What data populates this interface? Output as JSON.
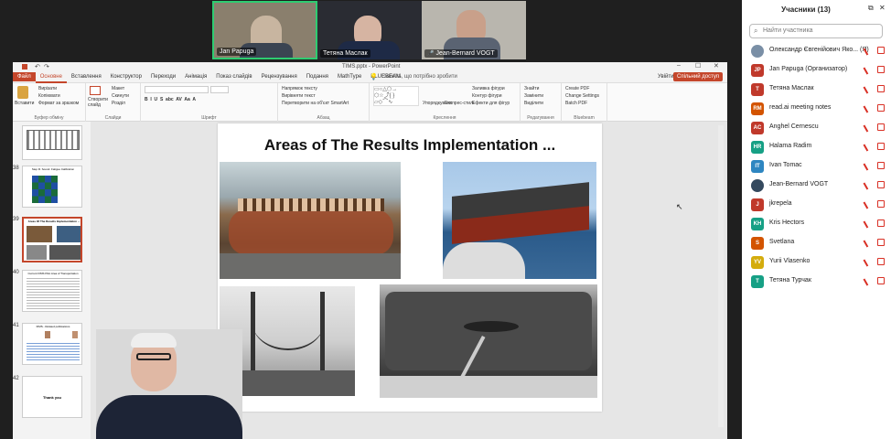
{
  "video_tiles": [
    {
      "name": "Jan Papuga",
      "mic": false
    },
    {
      "name": "Тетяна Маслак",
      "mic": false
    },
    {
      "name": "Jean-Bernard VOGT",
      "mic": true
    }
  ],
  "ppt": {
    "title": "TIMS.pptx - PowerPoint",
    "search_placeholder": "Скажіть, що потрібно зробити",
    "login_label": "Увійти",
    "share_label": "Спільний доступ",
    "tabs": [
      "Файл",
      "Основне",
      "Вставлення",
      "Конструктор",
      "Переходи",
      "Анімація",
      "Показ слайдів",
      "Рецензування",
      "Подання",
      "MathType",
      "BLUEBEAM"
    ],
    "ribbon": {
      "paste": "Вставити",
      "cut": "Вирізати",
      "copy": "Копіювати",
      "format_painter": "Формат за зразком",
      "clipboard": "Буфер обміну",
      "new_slide": "Створити слайд",
      "layout": "Макет",
      "reset": "Скинути",
      "section": "Розділ",
      "slides_group": "Слайди",
      "font_group": "Шрифт",
      "text_direction": "Напрямок тексту",
      "align_text": "Вирівняти текст",
      "smartart": "Перетворити на об'єкт SmartArt",
      "paragraph_group": "Абзац",
      "arrange": "Упорядкувати",
      "quick_styles": "Експрес-стилі",
      "shape_fill": "Заливка фігури",
      "shape_outline": "Контур фігури",
      "shape_effects": "Ефекти для фігур",
      "drawing_group": "Креслення",
      "find": "Знайти",
      "replace": "Замінити",
      "select": "Виділити",
      "editing_group": "Редагування",
      "create_pdf": "Create PDF",
      "change_settings": "Change Settings",
      "batch_pdf": "Batch PDF",
      "bluebeam_group": "Bluebeam"
    },
    "thumbs": [
      {
        "num": "",
        "title": ""
      },
      {
        "num": "38",
        "title": "Step R. Sound. Fatigue Calibration"
      },
      {
        "num": "39",
        "title": "Areas Of The Results Implementation ..."
      },
      {
        "num": "40",
        "title": "Current FIMS Pilot Area of Transportation"
      },
      {
        "num": "41",
        "title": "FIMS - Related publications"
      },
      {
        "num": "42",
        "title": "Thank you"
      }
    ],
    "slide": {
      "title": "Areas of The Results Implementation ..."
    }
  },
  "participants": {
    "header": "Учасники (13)",
    "search_placeholder": "Найти участника",
    "list": [
      {
        "initials": "",
        "name": "Олександр Євгенійович Яко... (Я)",
        "color": "#7a8fa6",
        "photo": true
      },
      {
        "initials": "JP",
        "name": "Jan Papuga (Организатор)",
        "color": "#c0392b"
      },
      {
        "initials": "T",
        "name": "Тетяна Маслак",
        "color": "#c0392b"
      },
      {
        "initials": "RM",
        "name": "read.ai meeting notes",
        "color": "#d35400"
      },
      {
        "initials": "AC",
        "name": "Anghel Cernescu",
        "color": "#c0392b"
      },
      {
        "initials": "HR",
        "name": "Halama Radim",
        "color": "#16a085"
      },
      {
        "initials": "IT",
        "name": "Ivan Tomac",
        "color": "#2e86c1"
      },
      {
        "initials": "",
        "name": "Jean-Bernard VOGT",
        "color": "#34495e",
        "photo": true
      },
      {
        "initials": "J",
        "name": "jkrepela",
        "color": "#c0392b"
      },
      {
        "initials": "KH",
        "name": "Kris Hectors",
        "color": "#16a085"
      },
      {
        "initials": "S",
        "name": "Svetlana",
        "color": "#d35400"
      },
      {
        "initials": "YV",
        "name": "Yurii Vlasenko",
        "color": "#d4ac0d"
      },
      {
        "initials": "T",
        "name": "Тетяна Турчак",
        "color": "#16a085"
      }
    ]
  },
  "colors": {
    "accent": "#c4462b",
    "mute": "#d93025"
  }
}
